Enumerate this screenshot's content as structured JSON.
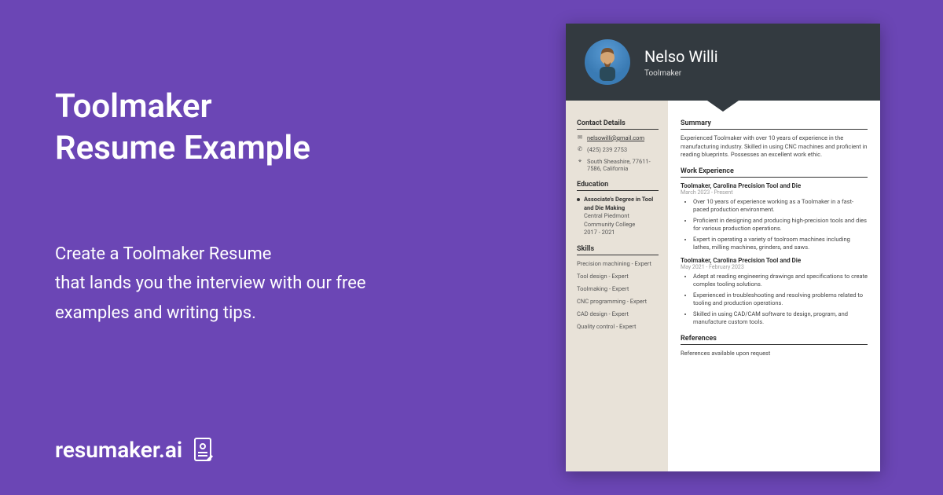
{
  "left": {
    "title_line1": "Toolmaker",
    "title_line2": "Resume Example",
    "subtitle_line1": "Create a Toolmaker Resume",
    "subtitle_line2": "that lands you the interview with our free",
    "subtitle_line3": "examples and writing tips.",
    "logo_text": "resumaker.ai"
  },
  "resume": {
    "name": "Nelso Willi",
    "role": "Toolmaker",
    "contact": {
      "heading": "Contact Details",
      "email": "nelsowilli@gmail.com",
      "phone": "(425) 239 2753",
      "address": "South Sheashire, 77611-7586, California"
    },
    "education": {
      "heading": "Education",
      "degree": "Associate's Degree in Tool and Die Making",
      "school": "Central Piedmont Community College",
      "years": "2017 - 2021"
    },
    "skills": {
      "heading": "Skills",
      "items": [
        "Precision machining - Expert",
        "Tool design - Expert",
        "Toolmaking - Expert",
        "CNC programming - Expert",
        "CAD design - Expert",
        "Quality control - Expert"
      ]
    },
    "summary": {
      "heading": "Summary",
      "text": "Experienced Toolmaker with over 10 years of experience in the manufacturing industry. Skilled in using CNC machines and proficient in reading blueprints. Possesses an excellent work ethic."
    },
    "experience": {
      "heading": "Work Experience",
      "jobs": [
        {
          "title": "Toolmaker, Carolina Precision Tool and Die",
          "dates": "March 2023 - Present",
          "bullets": [
            "Over 10 years of experience working as a Toolmaker in a fast-paced production environment.",
            "Proficient in designing and producing high-precision tools and dies for various production operations.",
            "Expert in operating a variety of toolroom machines including lathes, milling machines, grinders, and saws."
          ]
        },
        {
          "title": "Toolmaker, Carolina Precision Tool and Die",
          "dates": "May 2021 - February 2023",
          "bullets": [
            "Adept at reading engineering drawings and specifications to create complex tooling solutions.",
            "Experienced in troubleshooting and resolving problems related to tooling and production operations.",
            "Skilled in using CAD/CAM software to design, program, and manufacture custom tools."
          ]
        }
      ]
    },
    "references": {
      "heading": "References",
      "text": "References available upon request"
    }
  }
}
